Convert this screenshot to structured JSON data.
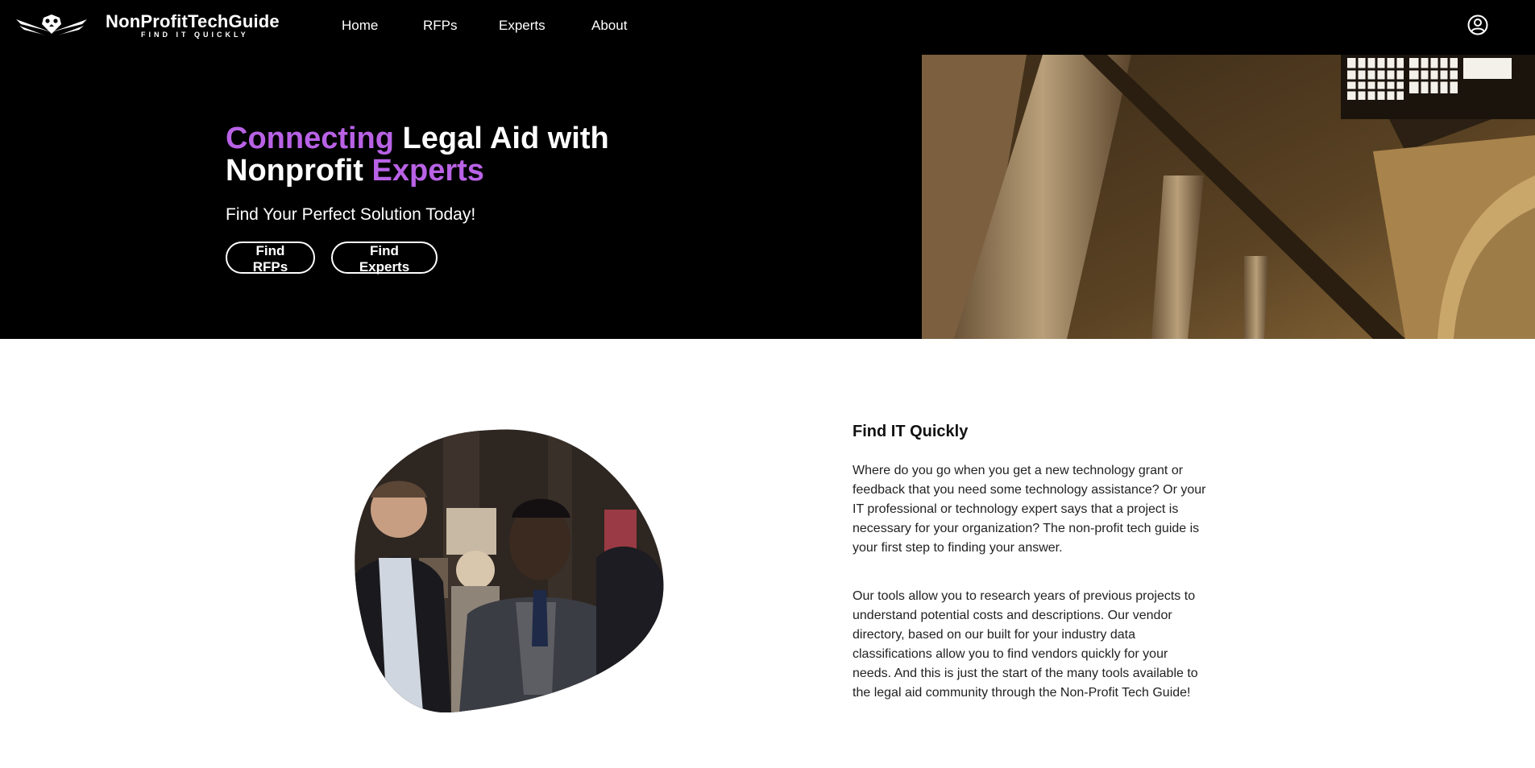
{
  "nav": {
    "brand_name": "NonProfitTechGuide",
    "brand_tagline": "FIND IT QUICKLY",
    "links": [
      "Home",
      "RFPs",
      "Experts",
      "About"
    ],
    "user_icon": "user-circle-icon"
  },
  "hero": {
    "title_part1": "Connecting",
    "title_part2": " Legal Aid with Nonprofit ",
    "title_part3": "Experts",
    "subtitle": "Find Your Perfect Solution Today!",
    "button_rfps": "Find RFPs",
    "button_experts": "Find Experts"
  },
  "content": {
    "title": "Find IT Quickly",
    "paragraph1": "Where do you go when you get a new technology grant or feedback that you need some technology assistance? Or your IT professional or technology expert says that a project is necessary for your organization? The non-profit tech guide is your first step to finding your answer.",
    "paragraph2": "Our tools allow you to research years of previous projects to understand potential costs and descriptions. Our vendor directory, based on our built for your industry data classifications allow you to find vendors quickly for your needs. And this is just the start of the many tools available to the legal aid community through the Non-Profit Tech Guide!"
  },
  "colors": {
    "accent_purple": "#b962e6",
    "accent_pink": "#d957b0",
    "background_dark": "#000000"
  }
}
